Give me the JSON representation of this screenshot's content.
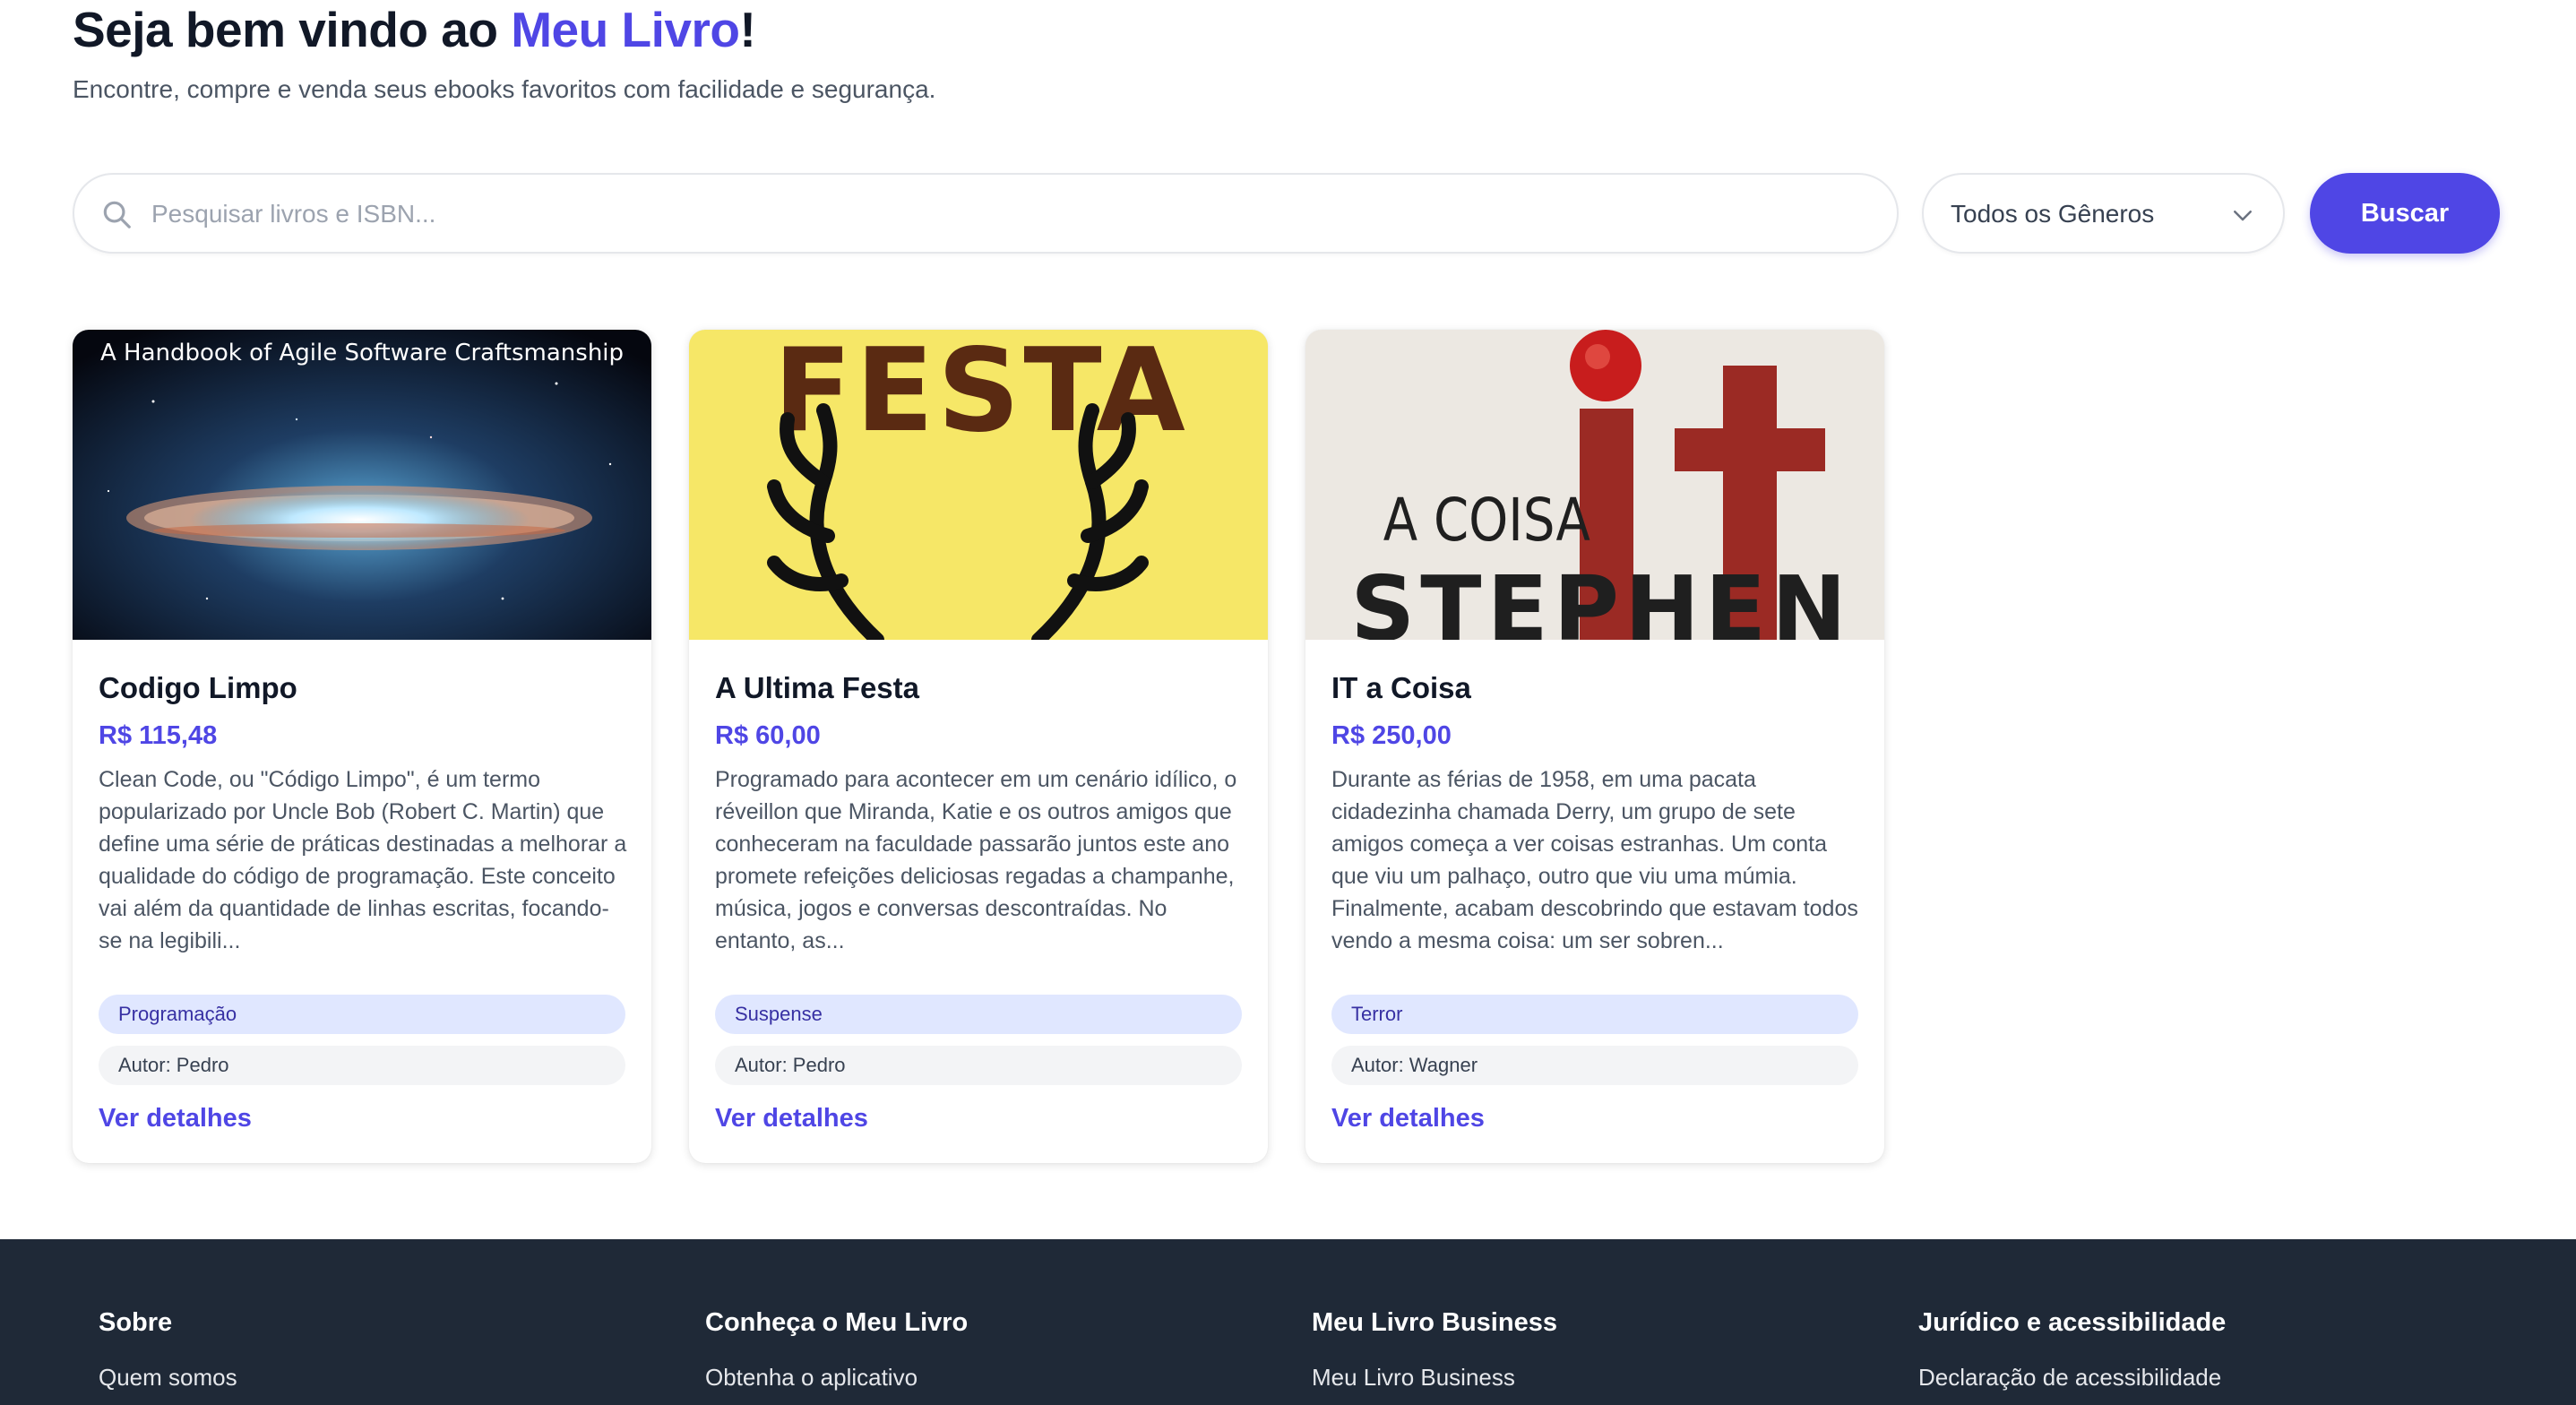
{
  "hero": {
    "title_prefix": "Seja bem vindo ao ",
    "title_brand": "Meu Livro",
    "title_suffix": "!",
    "subtitle": "Encontre, compre e venda seus ebooks favoritos com facilidade e segurança."
  },
  "search": {
    "placeholder": "Pesquisar livros e ISBN...",
    "value": "",
    "genre_selected": "Todos os Gêneros",
    "button_label": "Buscar"
  },
  "colors": {
    "accent": "#4f46e5",
    "footer_bg": "#1f2937",
    "genre_pill_bg": "#e0e7ff",
    "author_pill_bg": "#f3f4f6"
  },
  "books": [
    {
      "cover_text": "A Handbook of Agile Software Craftsmanship",
      "title": "Codigo Limpo",
      "price": "R$ 115,48",
      "description": "Clean Code, ou \"Código Limpo\", é um termo popularizado por Uncle Bob (Robert C. Martin) que define uma série de práticas destinadas a melhorar a qualidade do código de programação. Este conceito vai além da quantidade de linhas escritas, focando-se na legibili...",
      "genre": "Programação",
      "author": "Autor: Pedro",
      "link": "Ver detalhes"
    },
    {
      "cover_text": "FESTA",
      "title": "A Ultima Festa",
      "price": "R$ 60,00",
      "description": "Programado para acontecer em um cenário idílico, o réveillon que Miranda, Katie e os outros amigos que conheceram na faculdade passarão juntos este ano promete refeições deliciosas regadas a champanhe, música, jogos e conversas descontraídas. No entanto, as...",
      "genre": "Suspense",
      "author": "Autor: Pedro",
      "link": "Ver detalhes"
    },
    {
      "cover_text": "A COISA",
      "cover_text_2": "STEPHEN",
      "title": "IT a Coisa",
      "price": "R$ 250,00",
      "description": "Durante as férias de 1958, em uma pacata cidadezinha chamada Derry, um grupo de sete amigos começa a ver coisas estranhas. Um conta que viu um palhaço, outro que viu uma múmia. Finalmente, acabam descobrindo que estavam todos vendo a mesma coisa: um ser sobren...",
      "genre": "Terror",
      "author": "Autor: Wagner",
      "link": "Ver detalhes"
    }
  ],
  "footer": {
    "columns": [
      {
        "heading": "Sobre",
        "links": [
          "Quem somos"
        ]
      },
      {
        "heading": "Conheça o Meu Livro",
        "links": [
          "Obtenha o aplicativo"
        ]
      },
      {
        "heading": "Meu Livro Business",
        "links": [
          "Meu Livro Business"
        ]
      },
      {
        "heading": "Jurídico e acessibilidade",
        "links": [
          "Declaração de acessibilidade"
        ]
      }
    ]
  }
}
